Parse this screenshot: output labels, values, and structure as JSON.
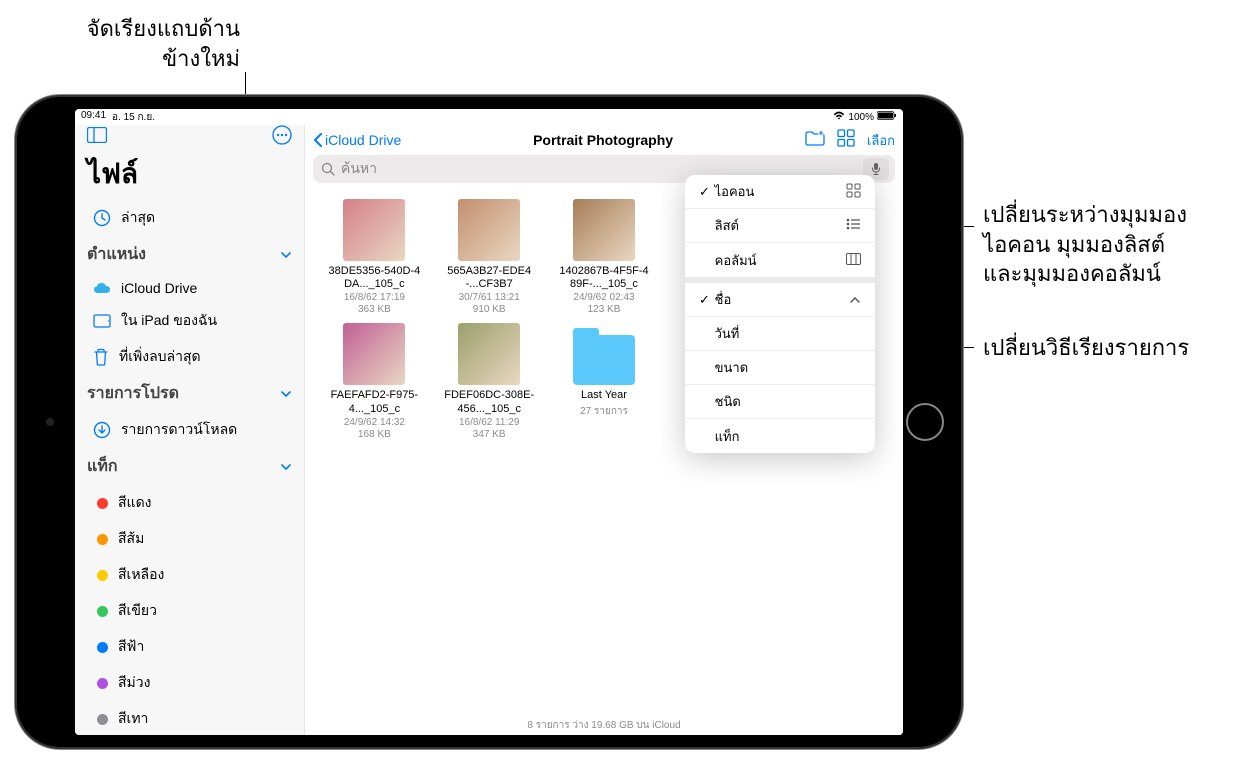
{
  "annotations": {
    "reorder_sidebar": "จัดเรียงแถบด้าน\nข้างใหม่",
    "switch_view": "เปลี่ยนระหว่างมุมมอง\nไอคอน มุมมองลิสต์\nและมุมมองคอลัมน์",
    "change_sort": "เปลี่ยนวิธีเรียงรายการ"
  },
  "status_bar": {
    "time": "09:41",
    "date": "อ. 15 ก.ย.",
    "battery": "100%"
  },
  "sidebar": {
    "title": "ไฟล์",
    "recents": "ล่าสุด",
    "locations_header": "ตำแหน่ง",
    "locations": [
      {
        "label": "iCloud Drive"
      },
      {
        "label": "ใน iPad ของฉัน"
      },
      {
        "label": "ที่เพิ่งลบล่าสุด"
      }
    ],
    "favorites_header": "รายการโปรด",
    "favorites": [
      {
        "label": "รายการดาวน์โหลด"
      }
    ],
    "tags_header": "แท็ก",
    "tags": [
      {
        "label": "สีแดง",
        "color": "#ff3b30"
      },
      {
        "label": "สีส้ม",
        "color": "#ff9500"
      },
      {
        "label": "สีเหลือง",
        "color": "#ffcc00"
      },
      {
        "label": "สีเขียว",
        "color": "#34c759"
      },
      {
        "label": "สีฟ้า",
        "color": "#007aff"
      },
      {
        "label": "สีม่วง",
        "color": "#af52de"
      },
      {
        "label": "สีเทา",
        "color": "#8e8e93"
      }
    ]
  },
  "toolbar": {
    "back": "iCloud Drive",
    "title": "Portrait Photography",
    "select": "เลือก"
  },
  "search": {
    "placeholder": "ค้นหา"
  },
  "popover": {
    "view": [
      {
        "label": "ไอคอน",
        "checked": true,
        "glyph": "grid"
      },
      {
        "label": "ลิสต์",
        "checked": false,
        "glyph": "list"
      },
      {
        "label": "คอลัมน์",
        "checked": false,
        "glyph": "columns"
      }
    ],
    "sort": [
      {
        "label": "ชื่อ",
        "checked": true,
        "glyph": "chevron-up"
      },
      {
        "label": "วันที่",
        "checked": false
      },
      {
        "label": "ขนาด",
        "checked": false
      },
      {
        "label": "ชนิด",
        "checked": false
      },
      {
        "label": "แท็ก",
        "checked": false
      }
    ]
  },
  "files": [
    {
      "name": "38DE5356-540D-4DA..._105_c",
      "date": "16/8/62 17:19",
      "size": "363 KB",
      "thumb": "#d47f88"
    },
    {
      "name": "565A3B27-EDE4-...CF3B7",
      "date": "30/7/61 13:21",
      "size": "910 KB",
      "thumb": "#c28f6e"
    },
    {
      "name": "1402867B-4F5F-489F-..._105_c",
      "date": "24/9/62 02:43",
      "size": "123 KB",
      "thumb": "#a67d57"
    },
    {
      "name": "FAEFAFD2-F975-4..._105_c",
      "date": "24/9/62 14:32",
      "size": "168 KB",
      "thumb": "#c06095"
    },
    {
      "name": "FDEF06DC-308E-456..._105_c",
      "date": "16/8/62 11:29",
      "size": "347 KB",
      "thumb": "#9aa06b"
    },
    {
      "name": "Last Year",
      "date": "27 รายการ",
      "size": "",
      "folder": true
    }
  ],
  "footer": "8 รายการ ว่าง 19.68 GB บน iCloud"
}
